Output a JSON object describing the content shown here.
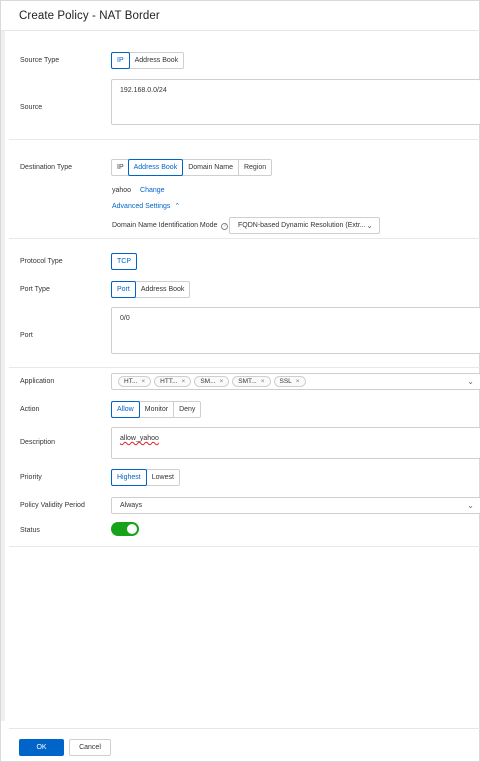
{
  "dialog": {
    "title": "Create Policy - NAT Border"
  },
  "source_type": {
    "label": "Source Type",
    "options": [
      "IP",
      "Address Book"
    ]
  },
  "source": {
    "label": "Source",
    "value": "192.168.0.0/24"
  },
  "destination_type": {
    "label": "Destination Type",
    "options": [
      "IP",
      "Address Book",
      "Domain Name",
      "Region"
    ]
  },
  "destination": {
    "value": "yahoo",
    "change_link": "Change",
    "advanced_settings": "Advanced Settings",
    "domain_mode_label": "Domain Name Identification Mode",
    "domain_mode_value": "FQDN-based Dynamic Resolution (Extr..."
  },
  "protocol_type": {
    "label": "Protocol Type",
    "options": [
      "TCP"
    ]
  },
  "port_type": {
    "label": "Port Type",
    "options": [
      "Port",
      "Address Book"
    ]
  },
  "port": {
    "label": "Port",
    "value": "0/0"
  },
  "application": {
    "label": "Application",
    "tags": [
      "HT...",
      "HTT...",
      "SM...",
      "SMT...",
      "SSL"
    ]
  },
  "action": {
    "label": "Action",
    "options": [
      "Allow",
      "Monitor",
      "Deny"
    ]
  },
  "description": {
    "label": "Description",
    "value": "allow_yahoo"
  },
  "priority": {
    "label": "Priority",
    "options": [
      "Highest",
      "Lowest"
    ]
  },
  "validity": {
    "label": "Policy Validity Period",
    "value": "Always"
  },
  "status": {
    "label": "Status",
    "enabled": true,
    "color": "#16a31a"
  },
  "footer": {
    "ok": "OK",
    "cancel": "Cancel"
  },
  "colors": {
    "accent": "#0064c8"
  }
}
